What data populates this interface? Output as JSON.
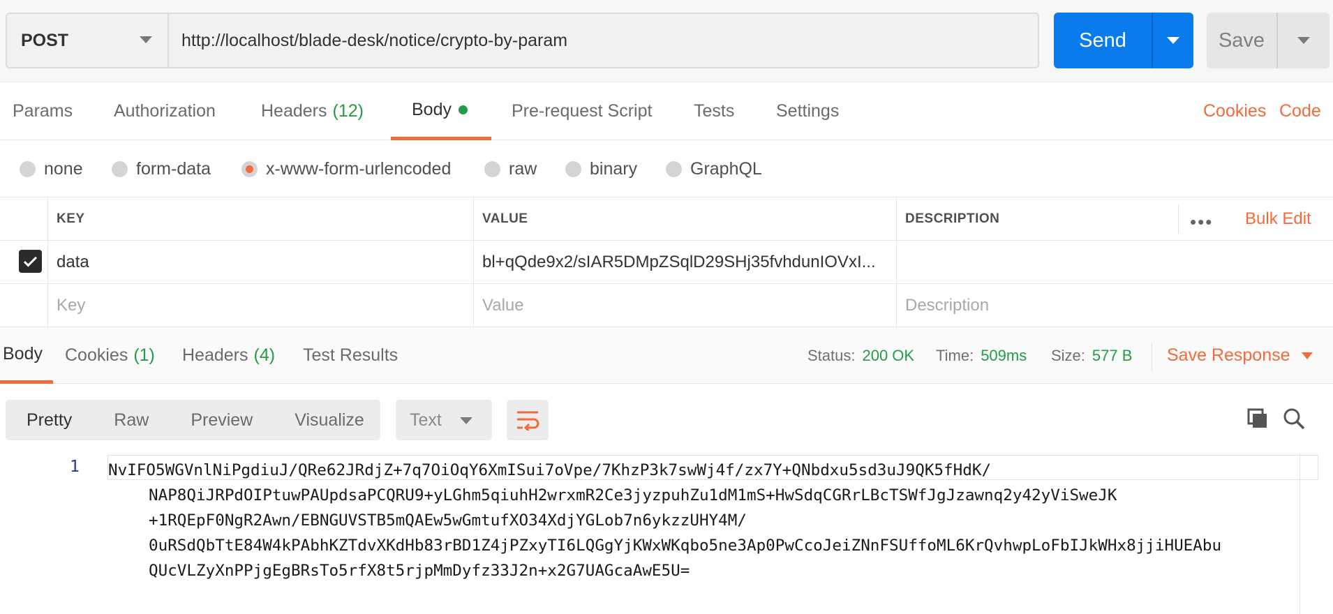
{
  "request": {
    "method": "POST",
    "url": "http://localhost/blade-desk/notice/crypto-by-param",
    "send_label": "Send",
    "save_label": "Save"
  },
  "request_tabs": {
    "params": "Params",
    "authorization": "Authorization",
    "headers": "Headers",
    "headers_count": "(12)",
    "body": "Body",
    "prerequest": "Pre-request Script",
    "tests": "Tests",
    "settings": "Settings",
    "cookies_link": "Cookies",
    "code_link": "Code"
  },
  "body_types": {
    "none": "none",
    "form_data": "form-data",
    "urlencoded": "x-www-form-urlencoded",
    "raw": "raw",
    "binary": "binary",
    "graphql": "GraphQL",
    "selected": "x-www-form-urlencoded"
  },
  "params_table": {
    "headers": {
      "key": "KEY",
      "value": "VALUE",
      "description": "DESCRIPTION"
    },
    "more_icon": "•••",
    "bulk_edit": "Bulk Edit",
    "rows": [
      {
        "checked": true,
        "key": "data",
        "value": "bl+qQde9x2/sIAR5DMpZSqlD29SHj35fvhdunIOVxI...",
        "description": ""
      }
    ],
    "placeholders": {
      "key": "Key",
      "value": "Value",
      "description": "Description"
    }
  },
  "response_tabs": {
    "body": "Body",
    "cookies": "Cookies",
    "cookies_count": "(1)",
    "headers": "Headers",
    "headers_count": "(4)",
    "test_results": "Test Results"
  },
  "response_status": {
    "status_label": "Status:",
    "status_value": "200 OK",
    "time_label": "Time:",
    "time_value": "509ms",
    "size_label": "Size:",
    "size_value": "577 B",
    "save_response": "Save Response"
  },
  "response_view": {
    "modes": [
      "Pretty",
      "Raw",
      "Preview",
      "Visualize"
    ],
    "active_mode": "Pretty",
    "format": "Text"
  },
  "response_body": {
    "line_number": "1",
    "lines": [
      "NvIFO5WGVnlNiPgdiuJ/QRe62JRdjZ+7q7OiOqY6XmISui7oVpe/7KhzP3k7swWj4f/zx7Y+QNbdxu5sd3uJ9QK5fHdK/",
      "NAP8QiJRPdOIPtuwPAUpdsaPCQRU9+yLGhm5qiuhH2wrxmR2Ce3jyzpuhZu1dM1mS+HwSdqCGRrLBcTSWfJgJzawnq2y42yViSweJK",
      "+1RQEpF0NgR2Awn/EBNGUVSTB5mQAEw5wGmtufXO34XdjYGLob7n6ykzzUHY4M/",
      "0uRSdQbTtE84W4kPAbhKZTdvXKdHb83rBD1Z4jPZxyTI6LQGgYjKWxWKqbo5ne3Ap0PwCcoJeiZNnFSUffoML6KrQvhwpLoFbIJkWHx8jjiHUEAbu",
      "QUcVLZyXnPPjgEgBRsTo5rfX8t5rjpMmDyfz33J2n+x2G7UAGcaAwE5U="
    ]
  }
}
